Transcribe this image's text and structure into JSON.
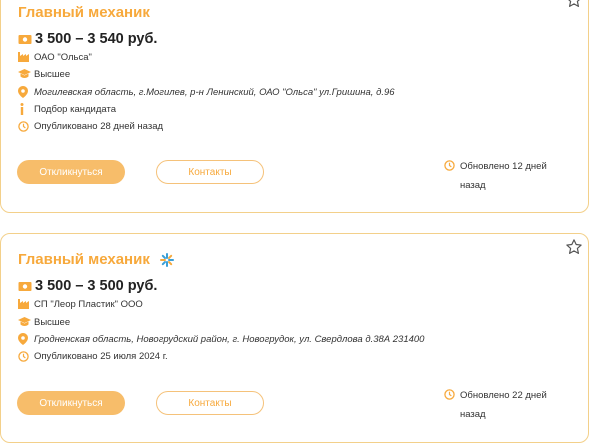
{
  "vacancies": [
    {
      "title": "Главный механик",
      "salary": "3 500 – 3 540 руб.",
      "company": "ОАО \"Ольса\"",
      "education": "Высшее",
      "address": "Могилевская область, г.Могилев, р-н Ленинский, ОАО \"Ольса\" ул.Гришина, д.96",
      "extra": "Подбор кандидата",
      "published": "Опубликовано 28 дней назад",
      "respond_label": "Откликнуться",
      "contacts_label": "Контакты",
      "updated_line1": "Обновлено 12 дней",
      "updated_line2": "назад"
    },
    {
      "title": "Главный механик",
      "salary": "3 500 – 3 500 руб.",
      "company": "СП \"Леор Пластик\" ООО",
      "education": "Высшее",
      "address": "Гродненская область, Новогрудский район, г. Новогрудок, ул. Свердлова д.38А 231400",
      "published": "Опубликовано 25 июля 2024 г.",
      "respond_label": "Откликнуться",
      "contacts_label": "Контакты",
      "updated_line1": "Обновлено 22 дней",
      "updated_line2": "назад"
    }
  ],
  "colors": {
    "accent": "#f7a93c",
    "button_fill": "#f7bd6a",
    "border": "#f3d08a"
  },
  "icons": [
    "money-icon",
    "company-icon",
    "graduation-cap-icon",
    "location-pin-icon",
    "info-icon",
    "clock-icon",
    "star-icon",
    "sparkle-icon"
  ]
}
